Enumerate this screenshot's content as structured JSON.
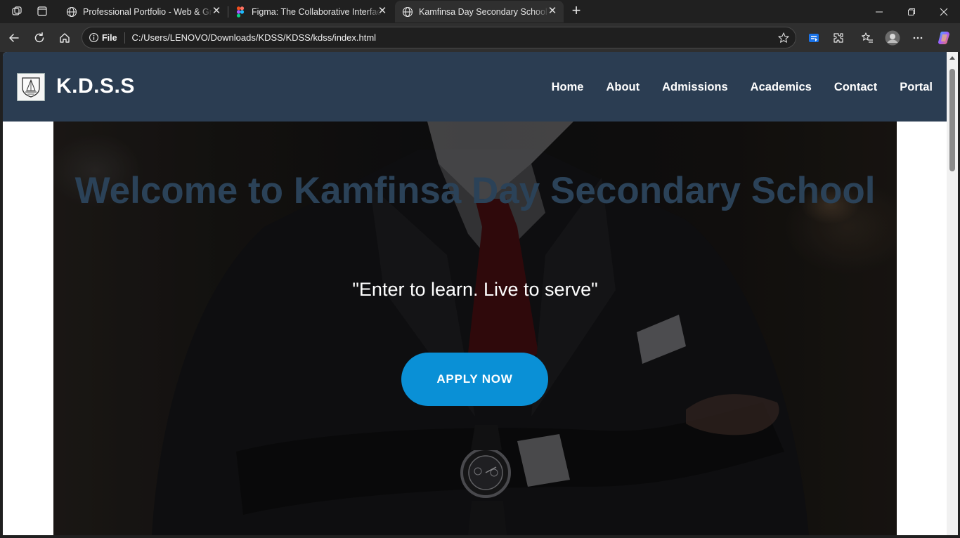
{
  "browser": {
    "tabs": [
      {
        "title": "Professional Portfolio - Web & Gr",
        "favicon": "globe-icon",
        "active": false
      },
      {
        "title": "Figma: The Collaborative Interface",
        "favicon": "figma-icon",
        "active": false
      },
      {
        "title": "Kamfinsa Day Secondary School -",
        "favicon": "globe-icon",
        "active": true
      }
    ],
    "address": {
      "scheme": "File",
      "url": "C:/Users/LENOVO/Downloads/KDSS/KDSS/kdss/index.html"
    }
  },
  "site": {
    "brand": "K.D.S.S",
    "nav": [
      "Home",
      "About",
      "Admissions",
      "Academics",
      "Contact",
      "Portal"
    ],
    "hero": {
      "title": "Welcome to Kamfinsa Day Secondary School",
      "motto": "\"Enter to learn. Live to serve\"",
      "cta": "APPLY NOW"
    },
    "colors": {
      "header": "#2b3d52",
      "title": "#2b4258",
      "button": "#0a90d6"
    }
  }
}
